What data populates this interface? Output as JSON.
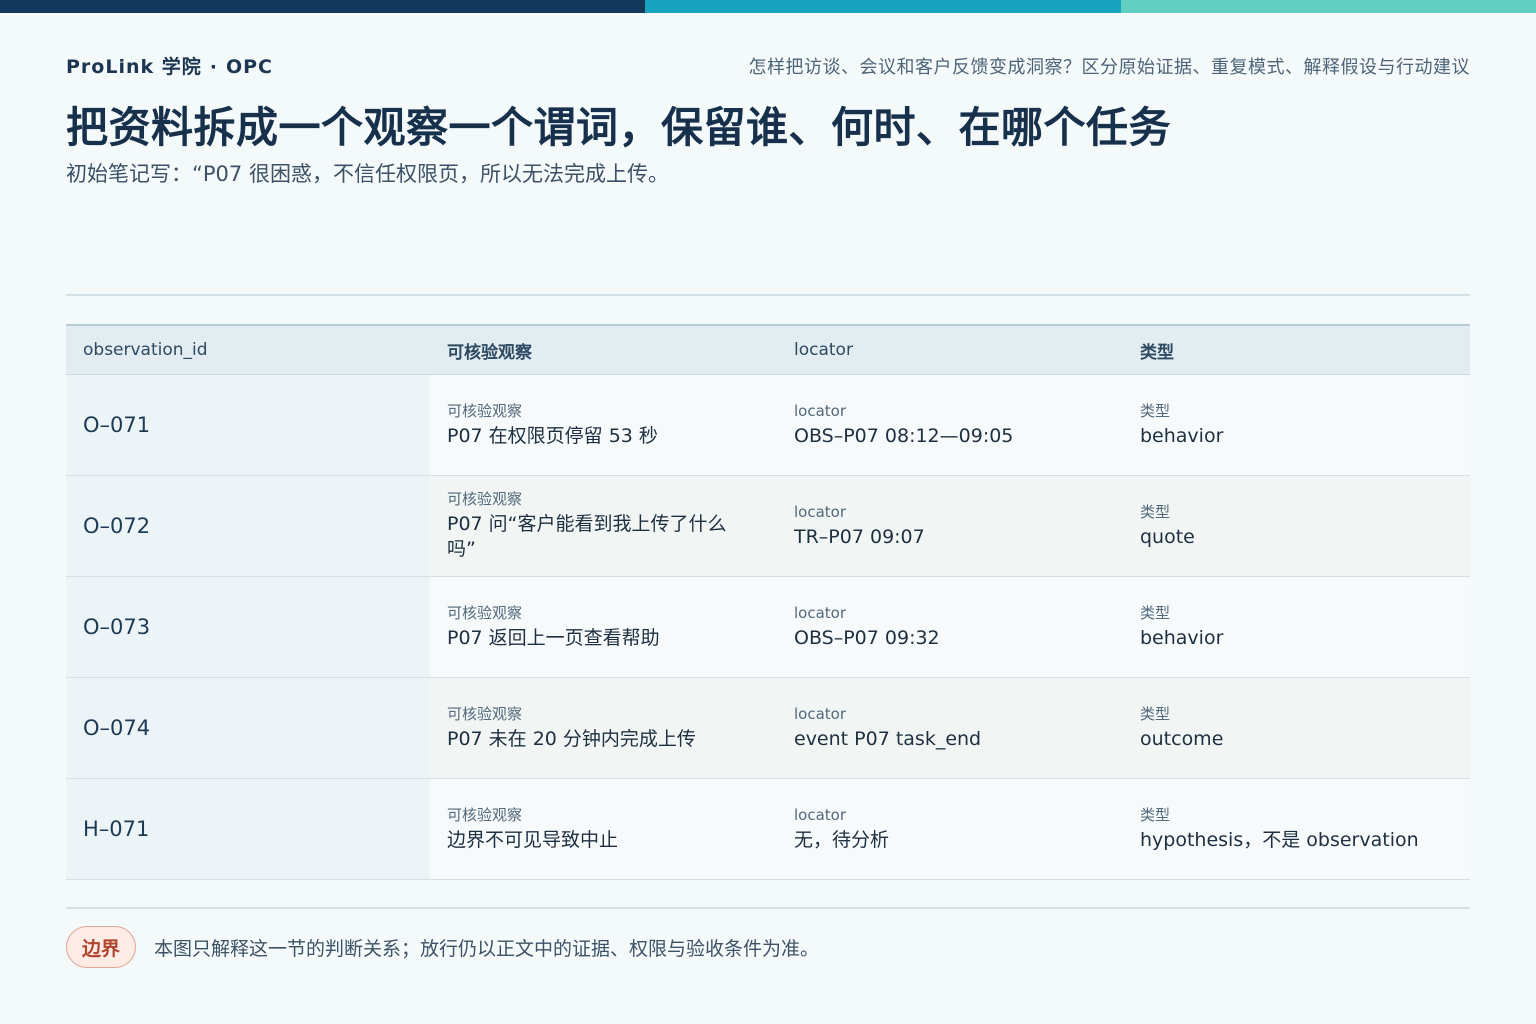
{
  "colors": {
    "bar_dark": "#12395c",
    "bar_mid": "#18a3be",
    "bar_light": "#63cfc0",
    "accent_pill": "#b0452e"
  },
  "header": {
    "brand": "ProLink 学院",
    "brand_dot": "·",
    "brand_suffix": "OPC",
    "question": "怎样把访谈、会议和客户反馈变成洞察？区分原始证据、重复模式、解释假设与行动建议",
    "title": "把资料拆成一个观察一个谓词，保留谁、何时、在哪个任务",
    "subtitle": "初始笔记写：“P07 很困惑，不信任权限页，所以无法完成上传。"
  },
  "table": {
    "headers": [
      "observation_id",
      "可核验观察",
      "locator",
      "类型"
    ],
    "rows": [
      {
        "id": "O–071",
        "obs_label": "可核验观察",
        "obs": "P07 在权限页停留 53 秒",
        "loc_label": "locator",
        "loc": "OBS–P07 08:12—09:05",
        "type_label": "类型",
        "type": "behavior"
      },
      {
        "id": "O–072",
        "obs_label": "可核验观察",
        "obs": "P07 问“客户能看到我上传了什么吗”",
        "loc_label": "locator",
        "loc": "TR–P07 09:07",
        "type_label": "类型",
        "type": "quote"
      },
      {
        "id": "O–073",
        "obs_label": "可核验观察",
        "obs": "P07 返回上一页查看帮助",
        "loc_label": "locator",
        "loc": "OBS–P07 09:32",
        "type_label": "类型",
        "type": "behavior"
      },
      {
        "id": "O–074",
        "obs_label": "可核验观察",
        "obs": "P07 未在 20 分钟内完成上传",
        "loc_label": "locator",
        "loc": "event P07 task_end",
        "type_label": "类型",
        "type": "outcome"
      },
      {
        "id": "H–071",
        "obs_label": "可核验观察",
        "obs": "边界不可见导致中止",
        "loc_label": "locator",
        "loc": "无，待分析",
        "type_label": "类型",
        "type": "hypothesis，不是 observation"
      }
    ]
  },
  "footer": {
    "badge": "边界",
    "note": "本图只解释这一节的判断关系；放行仍以正文中的证据、权限与验收条件为准。"
  }
}
